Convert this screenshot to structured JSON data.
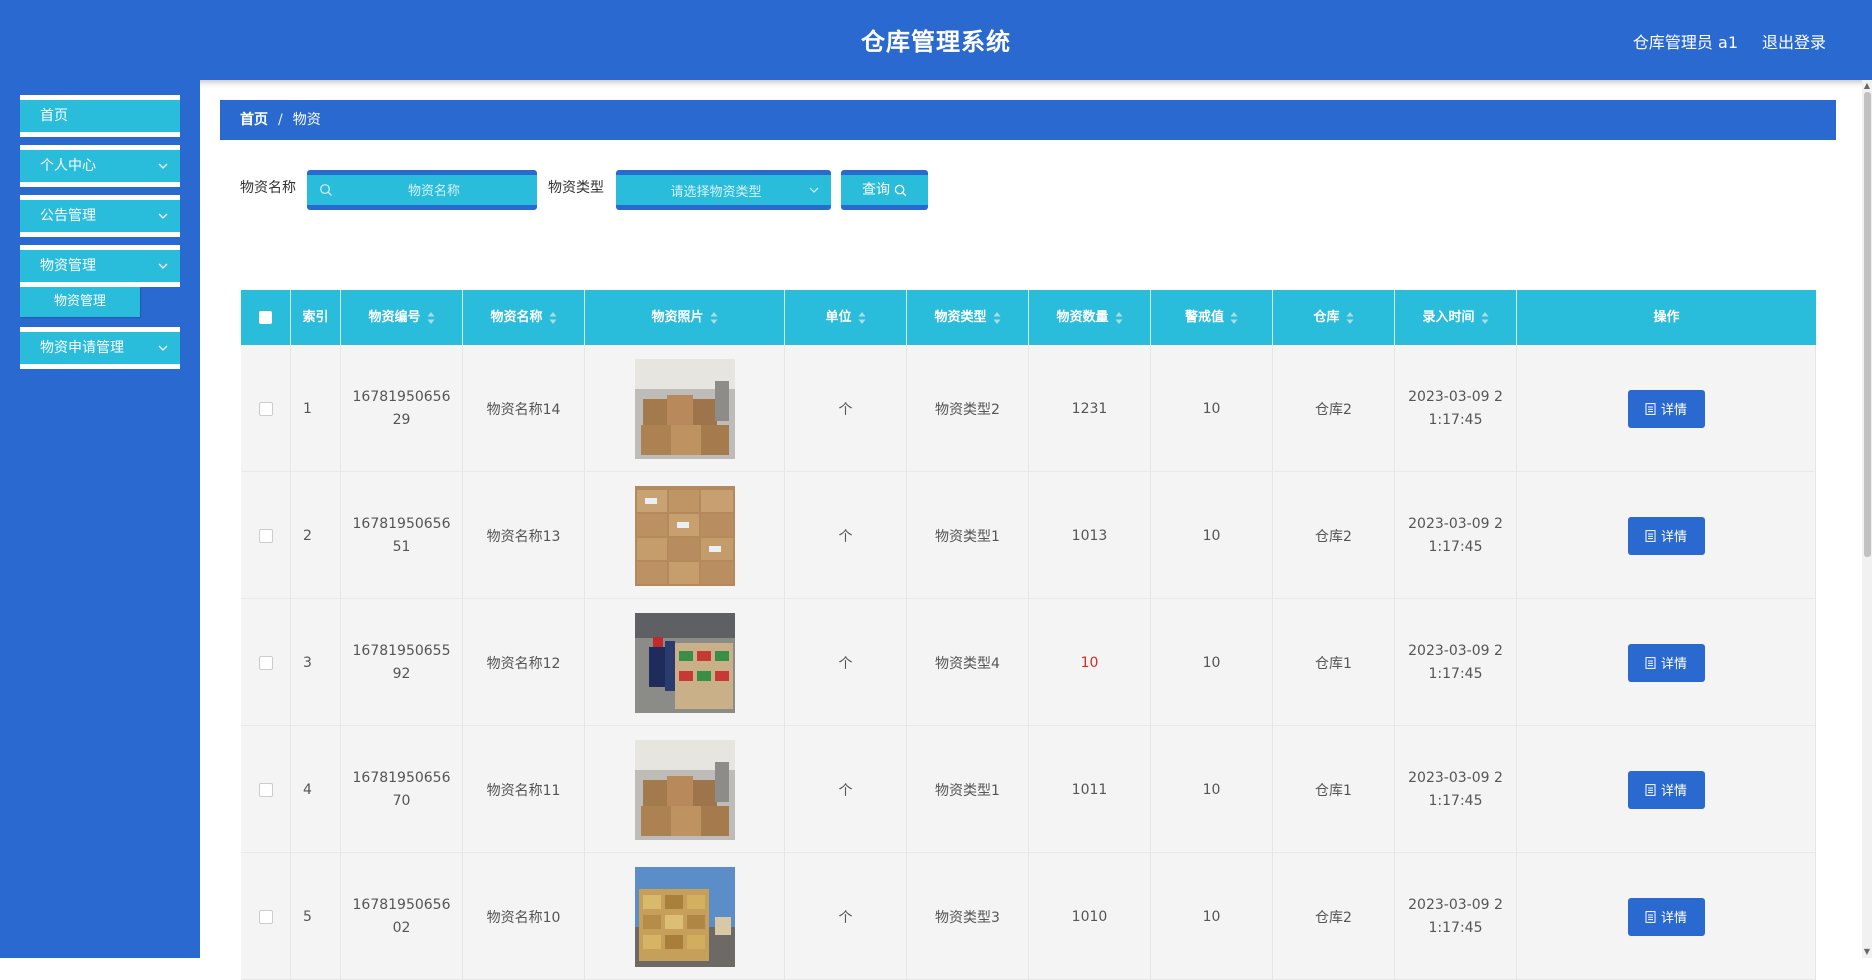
{
  "header": {
    "title": "仓库管理系统",
    "user": "仓库管理员 a1",
    "logout": "退出登录"
  },
  "sidebar": {
    "items": [
      {
        "label": "首页"
      },
      {
        "label": "个人中心"
      },
      {
        "label": "公告管理"
      },
      {
        "label": "物资管理"
      },
      {
        "label": "物资申请管理"
      }
    ],
    "sub_item": "物资管理"
  },
  "breadcrumb": {
    "home": "首页",
    "sep": "/",
    "current": "物资"
  },
  "search": {
    "name_label": "物资名称",
    "name_placeholder": "物资名称",
    "type_label": "物资类型",
    "type_placeholder": "请选择物资类型",
    "query_label": "查询"
  },
  "table": {
    "headers": {
      "index": "索引",
      "code": "物资编号",
      "name": "物资名称",
      "photo": "物资照片",
      "unit": "单位",
      "type": "物资类型",
      "qty": "物资数量",
      "alert": "警戒值",
      "warehouse": "仓库",
      "time": "录入时间",
      "ops": "操作"
    },
    "detail_label": "详情",
    "rows": [
      {
        "index": "1",
        "code": "1678195065629",
        "name": "物资名称14",
        "unit": "个",
        "type": "物资类型2",
        "qty": "1231",
        "alert": "10",
        "warehouse": "仓库2",
        "time": "2023-03-09 21:17:45"
      },
      {
        "index": "2",
        "code": "1678195065651",
        "name": "物资名称13",
        "unit": "个",
        "type": "物资类型1",
        "qty": "1013",
        "alert": "10",
        "warehouse": "仓库2",
        "time": "2023-03-09 21:17:45"
      },
      {
        "index": "3",
        "code": "1678195065592",
        "name": "物资名称12",
        "unit": "个",
        "type": "物资类型4",
        "qty": "10",
        "alert": "10",
        "warehouse": "仓库1",
        "time": "2023-03-09 21:17:45"
      },
      {
        "index": "4",
        "code": "1678195065670",
        "name": "物资名称11",
        "unit": "个",
        "type": "物资类型1",
        "qty": "1011",
        "alert": "10",
        "warehouse": "仓库1",
        "time": "2023-03-09 21:17:45"
      },
      {
        "index": "5",
        "code": "1678195065602",
        "name": "物资名称10",
        "unit": "个",
        "type": "物资类型3",
        "qty": "1010",
        "alert": "10",
        "warehouse": "仓库2",
        "time": "2023-03-09 21:17:45"
      }
    ]
  },
  "colors": {
    "primary": "#2a69cf",
    "accent": "#29bcdb",
    "warn": "#d52a2a"
  }
}
